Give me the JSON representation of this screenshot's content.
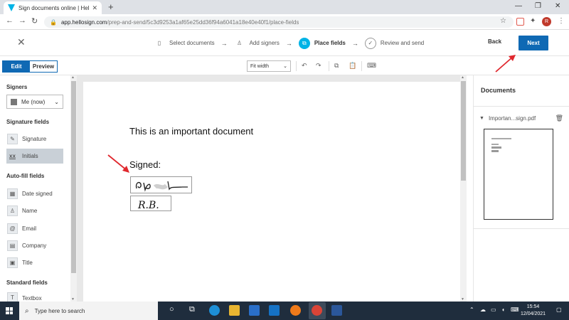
{
  "browser": {
    "tab_title": "Sign documents online | HelloSi",
    "tab_close": "✕",
    "new_tab": "+",
    "url_host": "app.hellosign.com",
    "url_path": "/prep-and-send/5c3d9253a1af65e25dd36f94a6041a18e40e40f1/place-fields",
    "profile_initial": "R"
  },
  "header": {
    "close": "✕",
    "steps": [
      {
        "label": "Select documents",
        "icon": "document-icon",
        "active": false
      },
      {
        "label": "Add signers",
        "icon": "person-icon",
        "active": false
      },
      {
        "label": "Place fields",
        "icon": "place-fields-icon",
        "active": true
      },
      {
        "label": "Review and send",
        "icon": "check-circle-icon",
        "active": false
      }
    ],
    "back_label": "Back",
    "next_label": "Next"
  },
  "editor_toolbar": {
    "edit_label": "Edit",
    "preview_label": "Preview",
    "zoom_value": "Fit width"
  },
  "left_panel": {
    "signers_title": "Signers",
    "signer_value": "Me (now)",
    "signature_fields_title": "Signature fields",
    "signature_label": "Signature",
    "initials_label": "Initials",
    "initials_icon_text": "xx",
    "autofill_title": "Auto-fill fields",
    "autofill_items": [
      "Date signed",
      "Name",
      "Email",
      "Company",
      "Title"
    ],
    "standard_title": "Standard fields",
    "standard_items": [
      "Textbox"
    ]
  },
  "document": {
    "title": "This is an important document",
    "signed_label": "Signed:",
    "initials_text": "R.B."
  },
  "right_panel": {
    "title": "Documents",
    "file_name": "Importan...sign.pdf"
  },
  "taskbar": {
    "search_placeholder": "Type here to search",
    "time": "15:54",
    "date": "12/04/2021"
  },
  "colors": {
    "accent": "#00b3e6",
    "primary_button": "#0f69b4",
    "annotation_arrow": "#e0282e",
    "taskbar": "#1f2d3d"
  }
}
